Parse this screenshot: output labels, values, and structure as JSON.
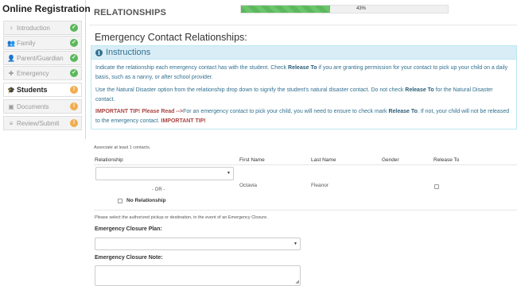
{
  "sidebar": {
    "title": "Online Registration",
    "items": [
      {
        "icon": "♀",
        "label": "Introduction",
        "status": "✓",
        "status_type": "ok"
      },
      {
        "icon": "👥",
        "label": "Family",
        "status": "✓",
        "status_type": "ok"
      },
      {
        "icon": "👤",
        "label": "Parent/Guardian",
        "status": "✓",
        "status_type": "ok"
      },
      {
        "icon": "✚",
        "label": "Emergency",
        "status": "✓",
        "status_type": "ok"
      },
      {
        "icon": "🎓",
        "label": "Students",
        "status": "!",
        "status_type": "warn"
      },
      {
        "icon": "▣",
        "label": "Documents",
        "status": "!",
        "status_type": "warn"
      },
      {
        "icon": "≡",
        "label": "Review/Submit",
        "status": "!",
        "status_type": "warn"
      }
    ]
  },
  "header": {
    "section": "RELATIONSHIPS",
    "progress_text": "43%",
    "progress_value": 0.43
  },
  "page_title": "Emergency Contact Relationships:",
  "instructions": {
    "title": "Instructions",
    "p1_a": "Indicate the relationship each emergency contact has with the student. Check ",
    "p1_b": "Release To",
    "p1_c": " if you are granting permission for your contact to pick up your child on a daily basis, such as a nanny, or after school provider.",
    "p2_a": "Use the Natural Disaster option from the relationship drop down to signify the student's natural disaster contact. Do not check ",
    "p2_b": "Release To",
    "p2_c": " for the Natural Disaster contact.",
    "p3_a": "IMPORTANT TIP! Please Read -->",
    "p3_b": "For an emergency contact to pick your child, you will need to ensure to check mark ",
    "p3_c": "Release To",
    "p3_d": ". If not, your child will not be released to the emergency contact. ",
    "p3_e": "IMPORTANT TIP!"
  },
  "contacts": {
    "associate_note": "Associate at least 1 contacts.",
    "headers": {
      "relationship": "Relationship",
      "first_name": "First Name",
      "last_name": "Last Name",
      "gender": "Gender",
      "release_to": "Release To"
    },
    "row": {
      "relationship_value": "",
      "first_name": "Octavia",
      "last_name": "Fleanor",
      "gender": "",
      "release_to": false
    },
    "or_text": "- OR -",
    "no_relationship_label": "No Relationship"
  },
  "closure": {
    "note": "Please select the authorized pickup or destination, in the event of an Emergency Closure.",
    "plan_label": "Emergency Closure Plan:",
    "plan_value": "",
    "note_label": "Emergency Closure Note:",
    "note_value": ""
  },
  "colors": {
    "ok": "#5cb85c",
    "warn": "#f0ad4e",
    "info": "#31708f",
    "danger": "#a94442"
  }
}
